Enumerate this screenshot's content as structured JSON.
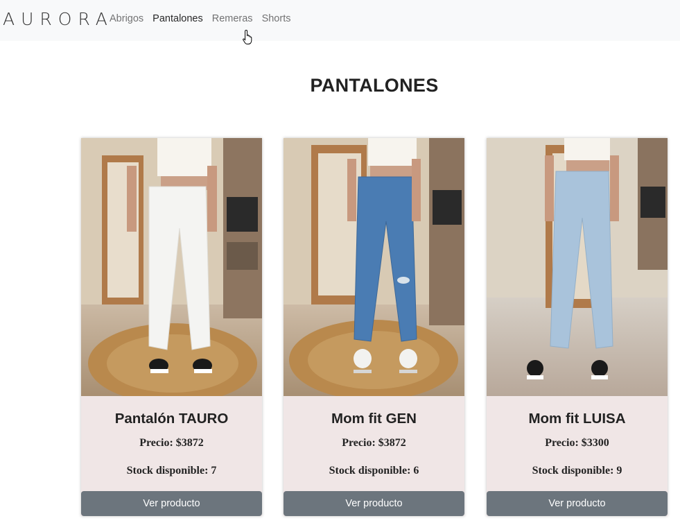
{
  "navbar": {
    "brand": "AURORA",
    "links": [
      {
        "label": "Abrigos",
        "active": false
      },
      {
        "label": "Pantalones",
        "active": true
      },
      {
        "label": "Remeras",
        "active": false
      },
      {
        "label": "Shorts",
        "active": false
      }
    ]
  },
  "page": {
    "title": "PANTALONES"
  },
  "products": [
    {
      "name": "Pantalón TAURO",
      "price": "Precio: $3872",
      "stock": "Stock disponible: 7",
      "button": "Ver producto",
      "jean_color": "#f4f4f2"
    },
    {
      "name": "Mom fit GEN",
      "price": "Precio: $3872",
      "stock": "Stock disponible: 6",
      "button": "Ver producto",
      "jean_color": "#4a7cb3"
    },
    {
      "name": "Mom fit LUISA",
      "price": "Precio: $3300",
      "stock": "Stock disponible: 9",
      "button": "Ver producto",
      "jean_color": "#a9c3db"
    }
  ],
  "colors": {
    "navbar_bg": "#f8f9fa",
    "card_bg": "#f0e6e6",
    "button_bg": "#6c757d"
  }
}
